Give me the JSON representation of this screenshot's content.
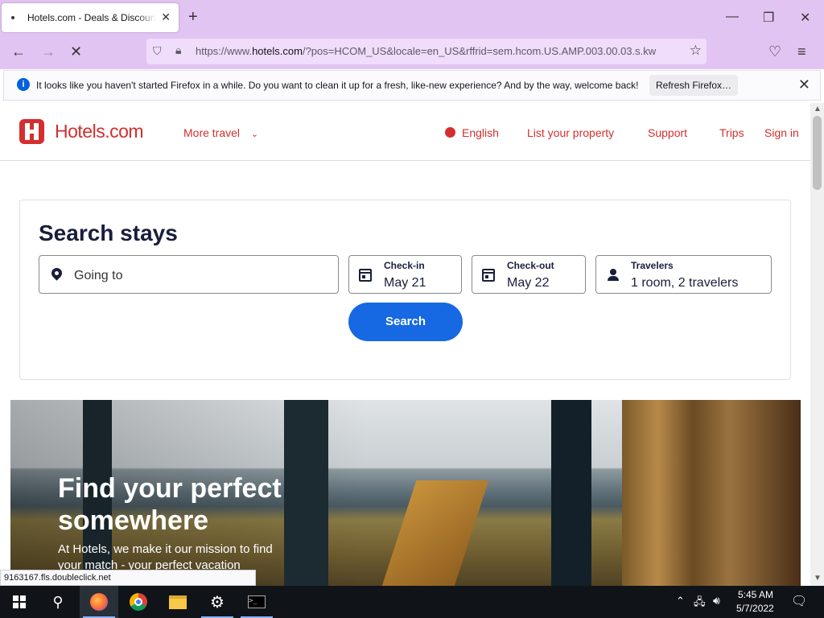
{
  "browser": {
    "tab_title": "Hotels.com - Deals & Discounts",
    "url_prefix": "https://www.",
    "url_domain": "hotels.com",
    "url_rest": "/?pos=HCOM_US&locale=en_US&rffrid=sem.hcom.US.AMP.003.00.03.s.kw",
    "notification": "It looks like you haven't started Firefox in a while. Do you want to clean it up for a fresh, like-new experience? And by the way, welcome back!",
    "refresh_label": "Refresh Firefox…",
    "status_url": "9163167.fls.doubleclick.net"
  },
  "header": {
    "logo": "Hotels.com",
    "more_travel": "More travel",
    "language": "English",
    "list_property": "List your property",
    "support": "Support",
    "trips": "Trips",
    "sign_in": "Sign in"
  },
  "search": {
    "title": "Search stays",
    "destination_placeholder": "Going to",
    "checkin_label": "Check-in",
    "checkin_value": "May 21",
    "checkout_label": "Check-out",
    "checkout_value": "May 22",
    "travelers_label": "Travelers",
    "travelers_value": "1 room, 2 travelers",
    "button": "Search"
  },
  "hero": {
    "title": "Find your perfect somewhere",
    "subtitle": "At Hotels, we make it our mission to find your match - your perfect vacation"
  },
  "taskbar": {
    "time": "5:45 AM",
    "date": "5/7/2022"
  },
  "colors": {
    "brand": "#d32f2f",
    "primary_button": "#1668e3",
    "chrome": "#e2c4f2"
  }
}
